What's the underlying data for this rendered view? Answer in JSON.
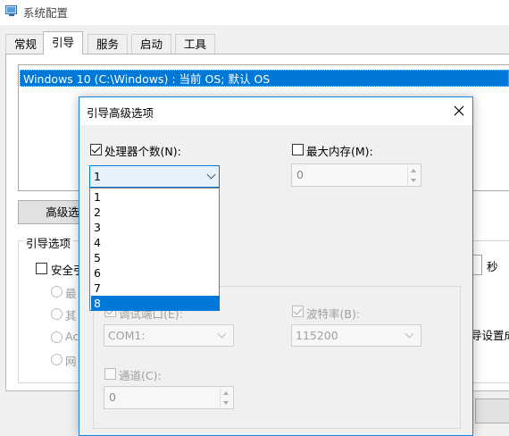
{
  "window": {
    "title": "系统配置",
    "icon": "system-config-icon"
  },
  "tabs": [
    {
      "label": "常规"
    },
    {
      "label": "引导"
    },
    {
      "label": "服务"
    },
    {
      "label": "启动"
    },
    {
      "label": "工具"
    }
  ],
  "active_tab": "引导",
  "boot_entries": [
    "Windows 10 (C:\\Windows) : 当前 OS; 默认 OS"
  ],
  "advanced_button": "高级选",
  "boot_options": {
    "legend": "引导选项",
    "safe_boot": "安全引",
    "radios": [
      "最",
      "其",
      "Ac",
      "网"
    ]
  },
  "timeout_unit": "秒",
  "right_partial_text": "导设置成",
  "dialog": {
    "title": "引导高级选项",
    "close_icon": "close-icon",
    "num_processors": {
      "label": "处理器个数(N):",
      "checked": true,
      "value": "1"
    },
    "max_memory": {
      "label": "最大内存(M):",
      "checked": false,
      "value": "0"
    },
    "processor_options": [
      "1",
      "2",
      "3",
      "4",
      "5",
      "6",
      "7",
      "8"
    ],
    "highlighted_option": "8",
    "debug": {
      "port_label": "调试端口(E):",
      "port_value": "COM1:",
      "baud_label": "波特率(B):",
      "baud_value": "115200",
      "channel_label": "通道(C):",
      "channel_value": "0"
    }
  },
  "colors": {
    "accent": "#0078d7",
    "dialog_border": "#1883d7"
  }
}
